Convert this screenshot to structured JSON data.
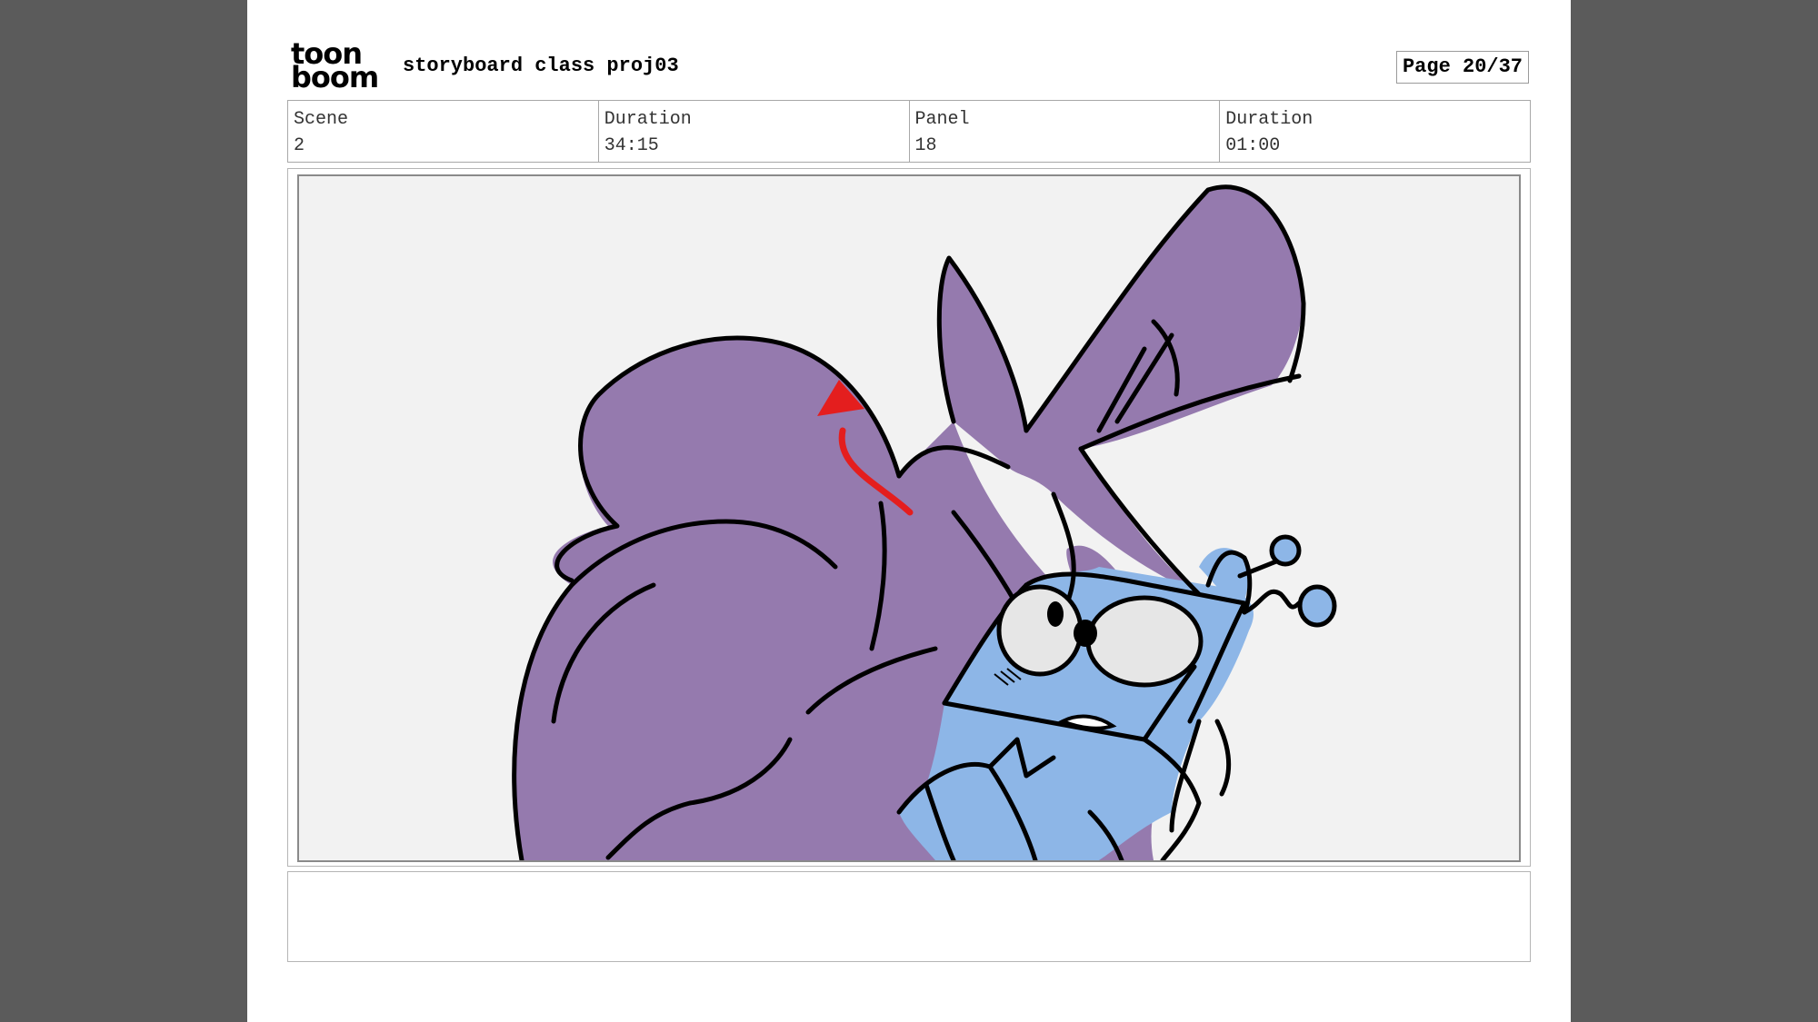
{
  "logo": {
    "line1": "toon",
    "line2": "boom"
  },
  "header": {
    "project_title": "storyboard class proj03",
    "page_label": "Page 20/37"
  },
  "info": {
    "scene_label": "Scene",
    "scene_value": "2",
    "scene_duration_label": "Duration",
    "scene_duration_value": "34:15",
    "panel_label": "Panel",
    "panel_value": "18",
    "panel_duration_label": "Duration",
    "panel_duration_value": "01:00"
  },
  "panel": {
    "colors": {
      "background": "#f2f2f2",
      "purple_character": "#957aae",
      "blue_character": "#8db6e7",
      "eye_white": "#e6e6e6",
      "motion_arrow": "#e41e1e"
    }
  },
  "notes": {
    "text": ""
  }
}
